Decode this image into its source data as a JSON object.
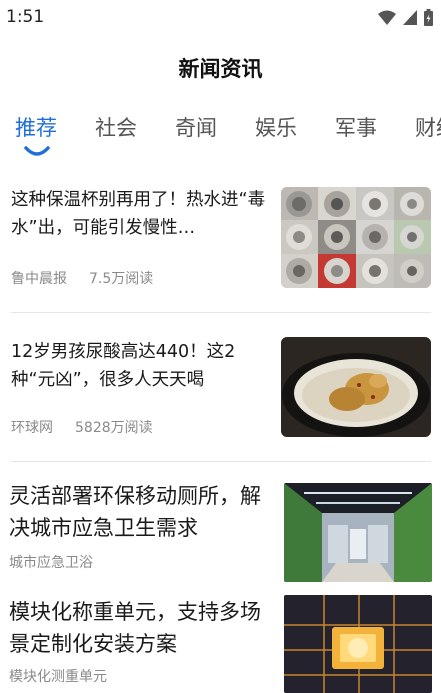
{
  "status_bar": {
    "time": "1:51"
  },
  "header": {
    "title": "新闻资讯"
  },
  "tabs": [
    {
      "label": "推荐",
      "active": true
    },
    {
      "label": "社会",
      "active": false
    },
    {
      "label": "奇闻",
      "active": false
    },
    {
      "label": "娱乐",
      "active": false
    },
    {
      "label": "军事",
      "active": false
    },
    {
      "label": "财经",
      "active": false
    }
  ],
  "colors": {
    "accent": "#1f6fd8",
    "meta_text": "#8a8a8a"
  },
  "news": [
    {
      "title": "这种保温杯别再用了！热水进“毒水”出，可能引发慢性…",
      "source": "鲁中晨报",
      "reads": "7.5万阅读",
      "image": "thermos-cups-grid"
    },
    {
      "title": "12岁男孩尿酸高达440！这2种“元凶”，很多人天天喝",
      "source": "环球网",
      "reads": "5828万阅读",
      "image": "chicken-soup-pot"
    }
  ],
  "ads": [
    {
      "title": "灵活部署环保移动厕所，解决城市应急卫生需求",
      "source": "城市应急卫浴",
      "image": "mobile-toilet-hall"
    },
    {
      "title": "模块化称重单元，支持多场景定制化安装方案",
      "source": "模块化测重单元",
      "image": "glowing-chip"
    }
  ]
}
